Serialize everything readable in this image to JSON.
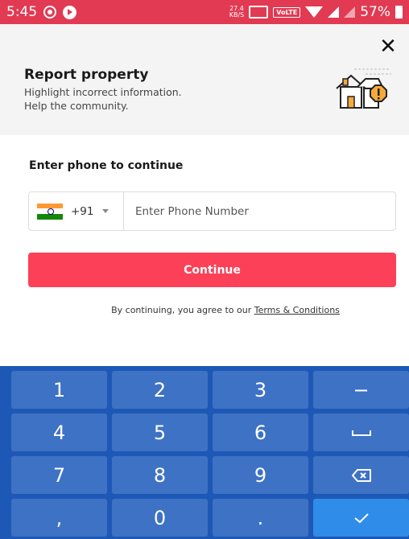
{
  "status_bar": {
    "time": "5:45",
    "net_speed_value": "27.4",
    "net_speed_unit": "KB/S",
    "volte": "VoLTE",
    "battery": "57%"
  },
  "header": {
    "title": "Report property",
    "subtitle_line1": "Highlight incorrect information.",
    "subtitle_line2": "Help the community.",
    "close_symbol": "✕"
  },
  "form": {
    "label": "Enter phone to continue",
    "country_code": "+91",
    "phone_placeholder": "Enter Phone Number",
    "phone_value": "",
    "continue_label": "Continue",
    "terms_prefix": "By continuing, you agree to our ",
    "terms_link": "Terms & Conditions"
  },
  "keypad": {
    "keys": [
      "1",
      "2",
      "3",
      "−",
      "4",
      "5",
      "6",
      "space",
      "7",
      "8",
      "9",
      "backspace",
      ",",
      "0",
      ".",
      "done"
    ]
  },
  "colors": {
    "status_bar": "#e13a52",
    "accent": "#fb4058",
    "keypad_bg": "#1e58b7",
    "key_bg": "#3e72c4",
    "key_done": "#2f8ce8"
  }
}
